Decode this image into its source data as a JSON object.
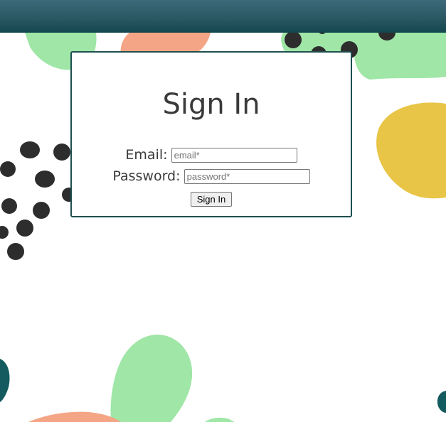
{
  "colors": {
    "header": "#2b5863",
    "green": "#9fe6a7",
    "salmon": "#f4a585",
    "dots": "#2d2d2d",
    "yellow": "#e8c547",
    "teal": "#135b5e",
    "card_border": "#1f4f50"
  },
  "signin": {
    "title": "Sign In",
    "email_label": "Email:",
    "email_placeholder": "email*",
    "email_value": "",
    "password_label": "Password:",
    "password_placeholder": "password*",
    "password_value": "",
    "submit_label": "Sign In"
  }
}
